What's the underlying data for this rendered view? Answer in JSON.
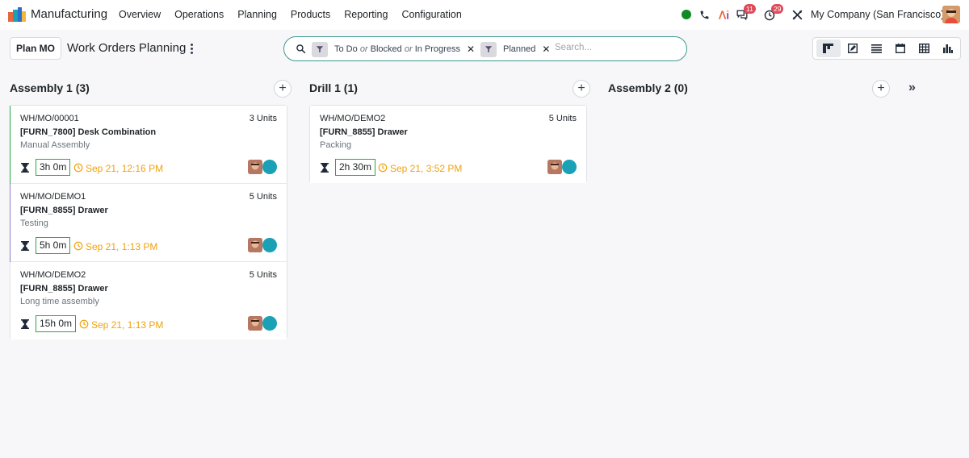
{
  "navbar": {
    "app_name": "Manufacturing",
    "menu": [
      "Overview",
      "Operations",
      "Planning",
      "Products",
      "Reporting",
      "Configuration"
    ],
    "messages_count": "11",
    "activities_count": "29",
    "company": "My Company (San Francisco)"
  },
  "control": {
    "plan_button": "Plan MO",
    "title": "Work Orders Planning",
    "facets": [
      {
        "parts": [
          "To Do",
          "or",
          "Blocked",
          "or",
          "In Progress"
        ]
      },
      {
        "parts": [
          "Planned"
        ]
      }
    ],
    "search_placeholder": "Search..."
  },
  "columns": [
    {
      "title": "Assembly 1 (3)",
      "cards": [
        {
          "mo": "WH/MO/00001",
          "qty": "3 Units",
          "product": "[FURN_7800] Desk Combination",
          "workcenter": "Manual Assembly",
          "duration": "3h 0m",
          "date": "Sep 21, 12:16 PM"
        },
        {
          "mo": "WH/MO/DEMO1",
          "qty": "5 Units",
          "product": "[FURN_8855] Drawer",
          "workcenter": "Testing",
          "duration": "5h 0m",
          "date": "Sep 21, 1:13 PM"
        },
        {
          "mo": "WH/MO/DEMO2",
          "qty": "5 Units",
          "product": "[FURN_8855] Drawer",
          "workcenter": "Long time assembly",
          "duration": "15h 0m",
          "date": "Sep 21, 1:13 PM"
        }
      ]
    },
    {
      "title": "Drill 1 (1)",
      "cards": [
        {
          "mo": "WH/MO/DEMO2",
          "qty": "5 Units",
          "product": "[FURN_8855] Drawer",
          "workcenter": "Packing",
          "duration": "2h 30m",
          "date": "Sep 21, 3:52 PM"
        }
      ]
    },
    {
      "title": "Assembly 2 (0)",
      "cards": []
    }
  ],
  "colors": {
    "accent": "#3c9a8f",
    "status_online": "#0f8a26",
    "date_warning": "#f0a20f",
    "duration_border": "#28a745",
    "state_dot": "#1ba1b5",
    "badge": "#e0495a"
  },
  "icons": {
    "app": "manufacturing-logo-icon",
    "phone": "phone-icon",
    "ai": "ai-icon",
    "messages": "chat-icon",
    "activities": "clock-icon",
    "tools": "tools-icon",
    "search": "search-icon",
    "filter": "filter-icon"
  }
}
